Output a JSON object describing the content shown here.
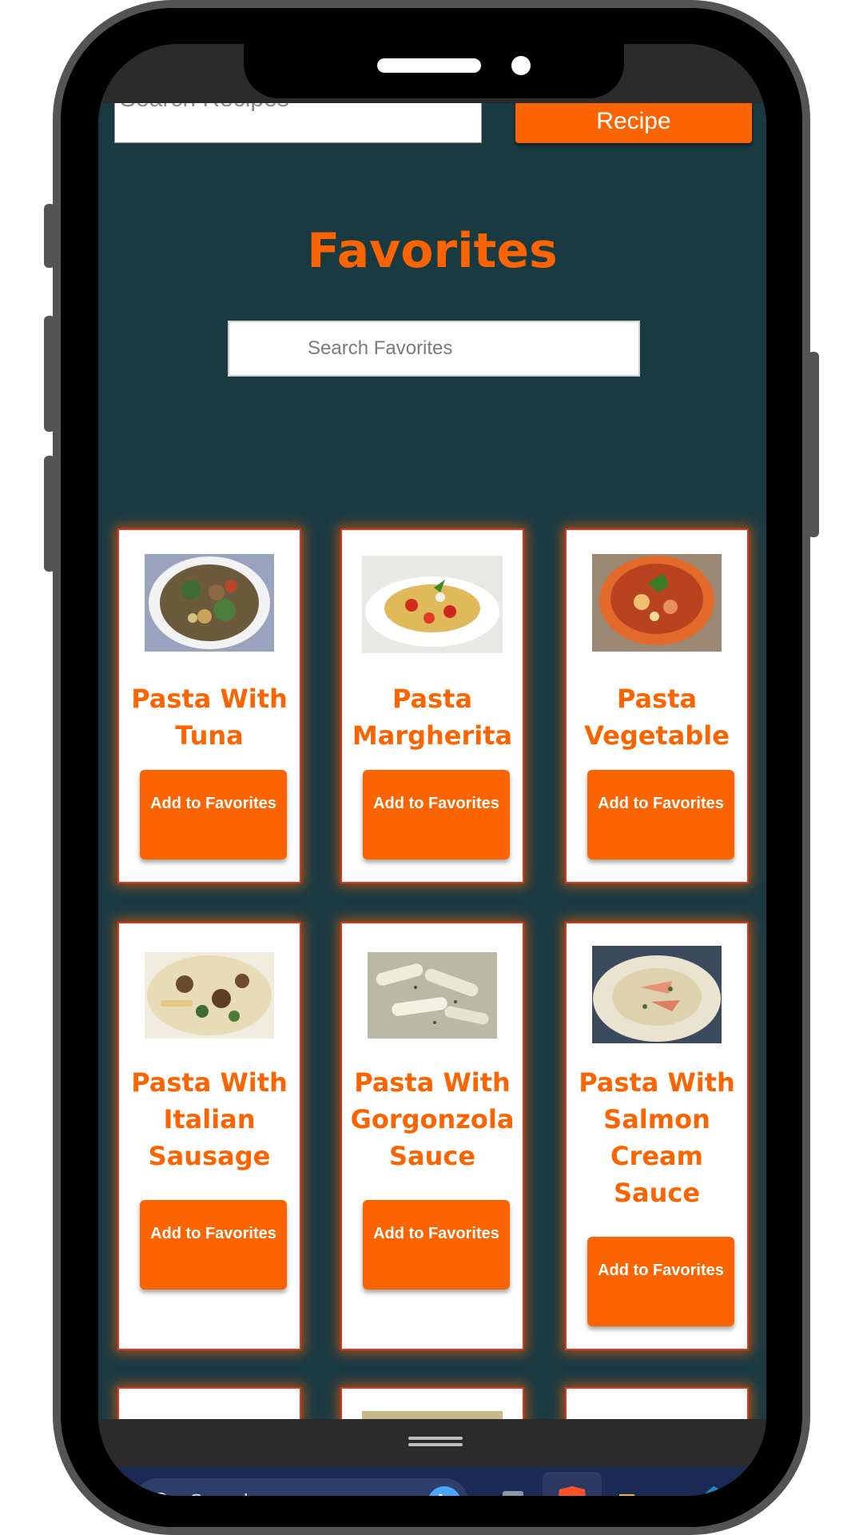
{
  "app": {
    "top_search_placeholder": "Search Recipes",
    "top_button_label": "Recipe",
    "page_title": "Favorites",
    "favorites_search_placeholder": "Search Favorites"
  },
  "recipes": [
    {
      "title": "Pasta With Tuna",
      "button": "Add to Favorites"
    },
    {
      "title": "Pasta Margherita",
      "button": "Add to Favorites"
    },
    {
      "title": "Pasta Vegetable",
      "button": "Add to Favorites"
    },
    {
      "title": "Pasta With Italian Sausage",
      "button": "Add to Favorites"
    },
    {
      "title": "Pasta With Gorgonzola Sauce",
      "button": "Add to Favorites"
    },
    {
      "title": "Pasta With Salmon Cream Sauce",
      "button": "Add to Favorites"
    }
  ],
  "taskbar": {
    "search_label": "Search",
    "bing_letter": "b",
    "icons": [
      "task-view-icon",
      "brave-browser-icon",
      "file-explorer-icon",
      "vscode-icon"
    ]
  },
  "colors": {
    "accent": "#fb6400",
    "background": "#1a3a42",
    "card_border": "#e0341b"
  }
}
